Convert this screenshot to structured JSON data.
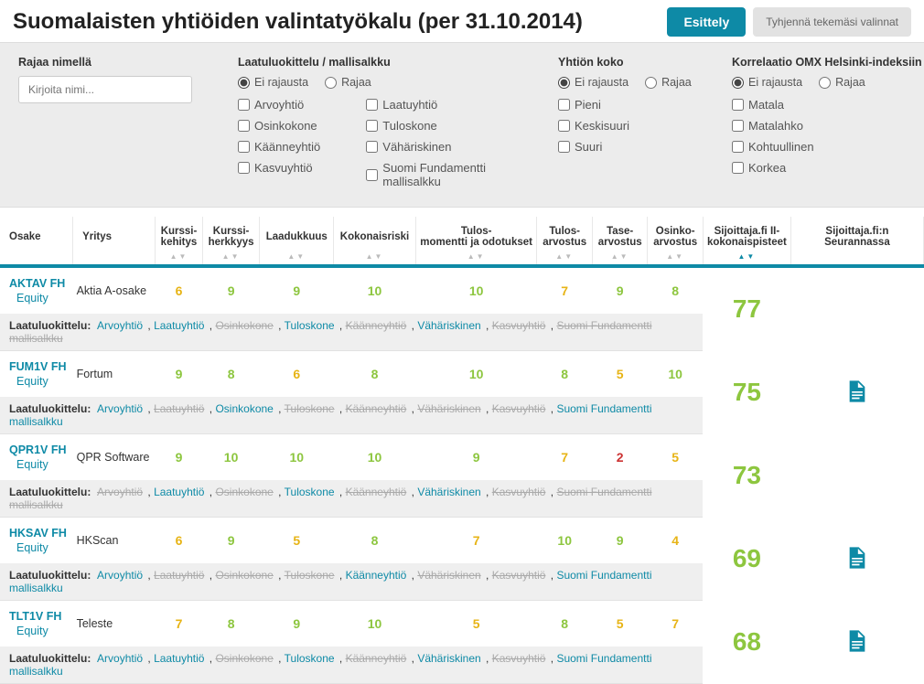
{
  "header": {
    "title": "Suomalaisten yhtiöiden valintatyökalu (per 31.10.2014)",
    "btn_primary": "Esittely",
    "btn_secondary": "Tyhjennä tekemäsi valinnat"
  },
  "filters": {
    "name": {
      "title": "Rajaa nimellä",
      "placeholder": "Kirjoita nimi..."
    },
    "quality": {
      "title": "Laatuluokittelu / mallisalkku",
      "radio_no": "Ei rajausta",
      "radio_yes": "Rajaa",
      "col1": [
        "Arvoyhtiö",
        "Osinkokone",
        "Käänneyhtiö",
        "Kasvuyhtiö"
      ],
      "col2": [
        "Laatuyhtiö",
        "Tuloskone",
        "Vähäriskinen",
        "Suomi Fundamentti mallisalkku"
      ]
    },
    "size": {
      "title": "Yhtiön koko",
      "radio_no": "Ei rajausta",
      "radio_yes": "Rajaa",
      "opts": [
        "Pieni",
        "Keskisuuri",
        "Suuri"
      ]
    },
    "corr": {
      "title": "Korrelaatio OMX Helsinki-indeksiin",
      "radio_no": "Ei rajausta",
      "radio_yes": "Rajaa",
      "opts": [
        "Matala",
        "Matalahko",
        "Kohtuullinen",
        "Korkea"
      ]
    }
  },
  "columns": [
    "Osake",
    "Yritys",
    "Kurssi-kehitys",
    "Kurssi-herkkyys",
    "Laadukkuus",
    "Kokonaisriski",
    "Tulos-momentti ja odotukset",
    "Tulos-arvostus",
    "Tase-arvostus",
    "Osinko-arvostus",
    "Sijoittaja.fi II-kokonaispisteet",
    "Sijoittaja.fi:n Seurannassa"
  ],
  "tag_row_label": "Laatuluokittelu:",
  "tag_names": [
    "Arvoyhtiö",
    "Laatuyhtiö",
    "Osinkokone",
    "Tuloskone",
    "Käänneyhtiö",
    "Vähäriskinen",
    "Kasvuyhtiö",
    "Suomi Fundamentti mallisalkku"
  ],
  "rows": [
    {
      "ticker": "AKTAV FH",
      "sub": "Equity",
      "company": "Aktia A-osake",
      "scores": [
        {
          "v": "6",
          "c": "yellow"
        },
        {
          "v": "9",
          "c": "green"
        },
        {
          "v": "9",
          "c": "green"
        },
        {
          "v": "10",
          "c": "green"
        },
        {
          "v": "10",
          "c": "green"
        },
        {
          "v": "7",
          "c": "yellow"
        },
        {
          "v": "9",
          "c": "green"
        },
        {
          "v": "8",
          "c": "green"
        }
      ],
      "total": "77",
      "doc": false,
      "tags": [
        1,
        1,
        0,
        1,
        0,
        1,
        0,
        0
      ]
    },
    {
      "ticker": "FUM1V FH",
      "sub": "Equity",
      "company": "Fortum",
      "scores": [
        {
          "v": "9",
          "c": "green"
        },
        {
          "v": "8",
          "c": "green"
        },
        {
          "v": "6",
          "c": "yellow"
        },
        {
          "v": "8",
          "c": "green"
        },
        {
          "v": "10",
          "c": "green"
        },
        {
          "v": "8",
          "c": "green"
        },
        {
          "v": "5",
          "c": "yellow"
        },
        {
          "v": "10",
          "c": "green"
        }
      ],
      "total": "75",
      "doc": true,
      "tags": [
        1,
        0,
        1,
        0,
        0,
        0,
        0,
        1
      ]
    },
    {
      "ticker": "QPR1V FH",
      "sub": "Equity",
      "company": "QPR Software",
      "scores": [
        {
          "v": "9",
          "c": "green"
        },
        {
          "v": "10",
          "c": "green"
        },
        {
          "v": "10",
          "c": "green"
        },
        {
          "v": "10",
          "c": "green"
        },
        {
          "v": "9",
          "c": "green"
        },
        {
          "v": "7",
          "c": "yellow"
        },
        {
          "v": "2",
          "c": "red"
        },
        {
          "v": "5",
          "c": "yellow"
        }
      ],
      "total": "73",
      "doc": false,
      "tags": [
        0,
        1,
        0,
        1,
        0,
        1,
        0,
        0
      ]
    },
    {
      "ticker": "HKSAV FH",
      "sub": "Equity",
      "company": "HKScan",
      "scores": [
        {
          "v": "6",
          "c": "yellow"
        },
        {
          "v": "9",
          "c": "green"
        },
        {
          "v": "5",
          "c": "yellow"
        },
        {
          "v": "8",
          "c": "green"
        },
        {
          "v": "7",
          "c": "yellow"
        },
        {
          "v": "10",
          "c": "green"
        },
        {
          "v": "9",
          "c": "green"
        },
        {
          "v": "4",
          "c": "yellow"
        }
      ],
      "total": "69",
      "doc": true,
      "tags": [
        1,
        0,
        0,
        0,
        1,
        0,
        0,
        1
      ]
    },
    {
      "ticker": "TLT1V FH",
      "sub": "Equity",
      "company": "Teleste",
      "scores": [
        {
          "v": "7",
          "c": "yellow"
        },
        {
          "v": "8",
          "c": "green"
        },
        {
          "v": "9",
          "c": "green"
        },
        {
          "v": "10",
          "c": "green"
        },
        {
          "v": "5",
          "c": "yellow"
        },
        {
          "v": "8",
          "c": "green"
        },
        {
          "v": "5",
          "c": "yellow"
        },
        {
          "v": "7",
          "c": "yellow"
        }
      ],
      "total": "68",
      "doc": true,
      "tags": [
        1,
        1,
        0,
        1,
        0,
        1,
        0,
        1
      ]
    }
  ]
}
